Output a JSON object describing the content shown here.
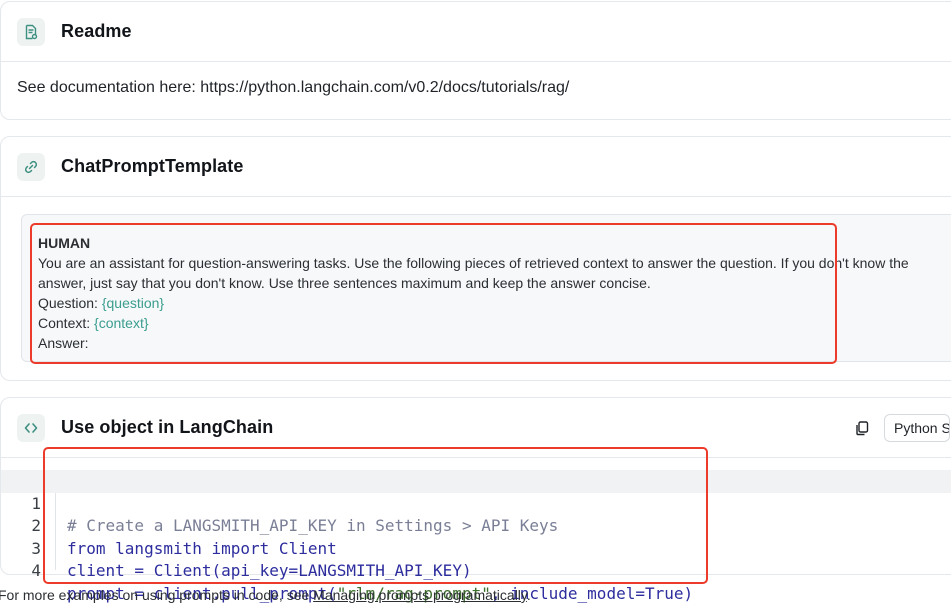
{
  "readme": {
    "title": "Readme",
    "icon": "document-icon",
    "body": "See documentation here: https://python.langchain.com/v0.2/docs/tutorials/rag/"
  },
  "prompt_template": {
    "title": "ChatPromptTemplate",
    "icon": "link-icon",
    "message": {
      "role": "HUMAN",
      "line1": "You are an assistant for question-answering tasks. Use the following pieces of retrieved context to answer the question. If you don't know the",
      "line2": "answer, just say that you don't know. Use three sentences maximum and keep the answer concise.",
      "question_label": "Question: ",
      "question_var": "{question}",
      "context_label": "Context: ",
      "context_var": "{context}",
      "answer_label": "Answer:"
    }
  },
  "usage": {
    "title": "Use object in LangChain",
    "icon": "code-brackets-icon",
    "copy_icon": "copy-icon",
    "language": "Python SDK",
    "code": {
      "line_numbers": [
        "1",
        "2",
        "3",
        "4"
      ],
      "line1_comment": "# Create a LANGSMITH_API_KEY in Settings > API Keys",
      "line2_kw1": "from",
      "line2_mid": " langsmith ",
      "line2_kw2": "import",
      "line2_end": " Client",
      "line3_a": "client = Client(api_key=LANGSMITH_API_KEY)",
      "line4_a": "prompt = client.pull_prompt(",
      "line4_str": "\"rlm/rag-prompt\"",
      "line4_b": ", include_model=True)"
    }
  },
  "footnote": {
    "text": "For more examples on using prompts in code, see ",
    "link": "Managing prompts programatically",
    "end": "."
  },
  "colors": {
    "highlight_border": "#ec3a2b",
    "variable": "#3a9d8f",
    "icon_bg": "#eef3f2"
  }
}
